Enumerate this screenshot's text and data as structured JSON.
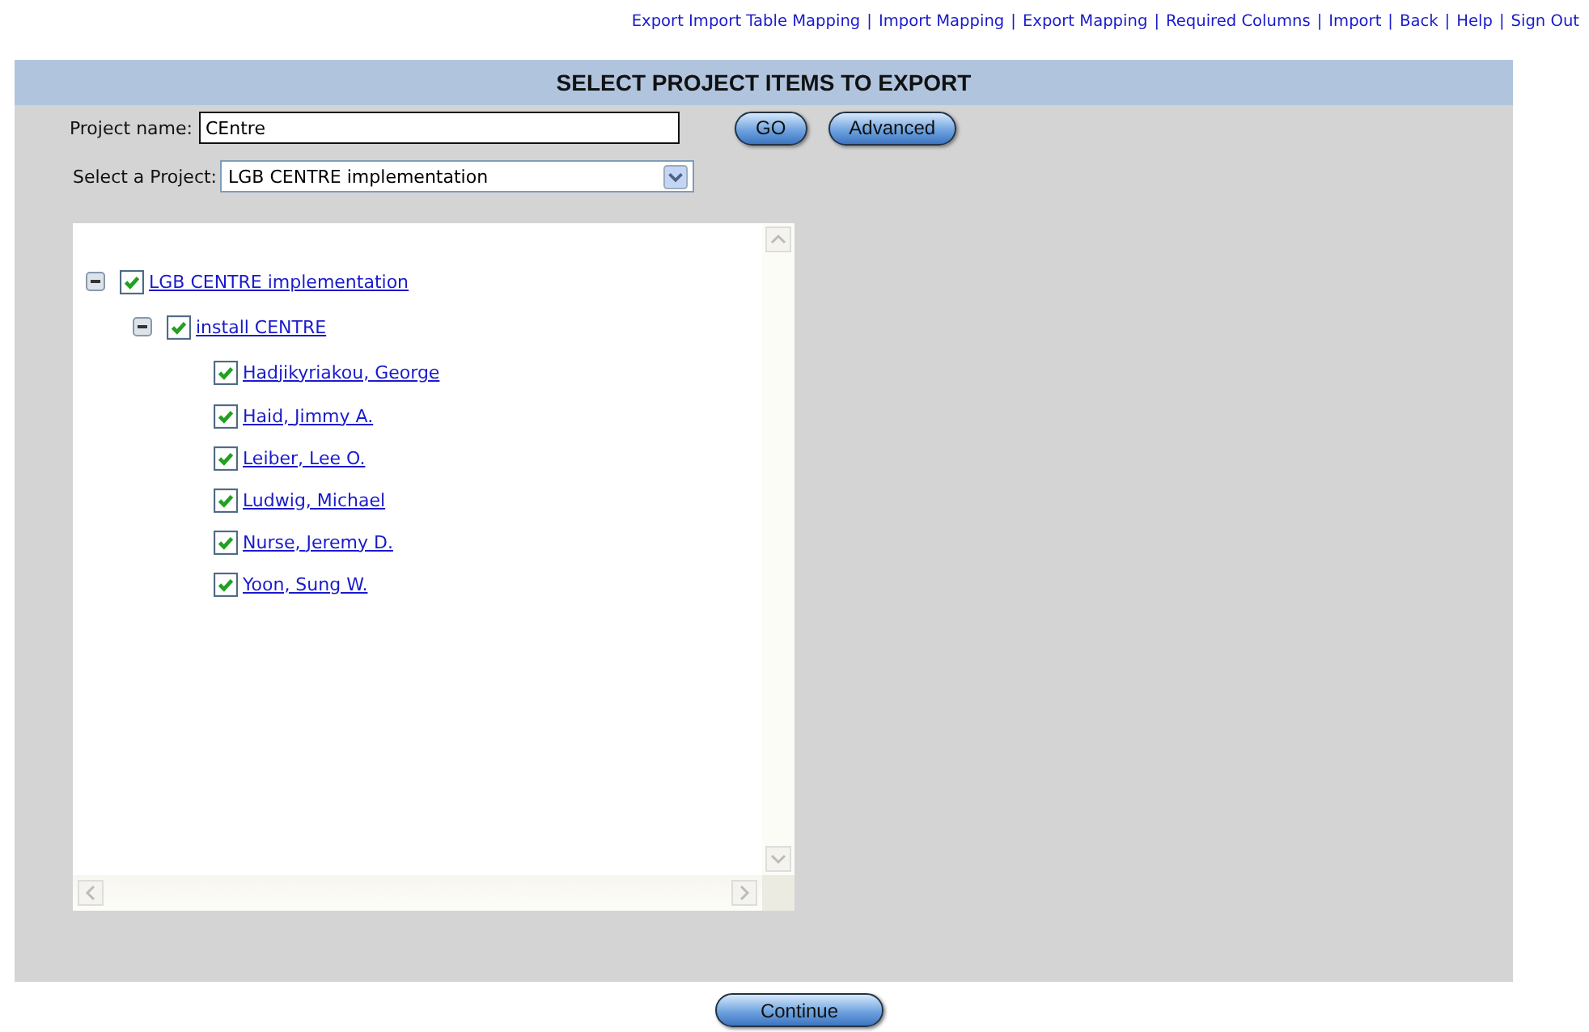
{
  "nav": {
    "separator": "|",
    "links": [
      "Export Import Table Mapping",
      "Import Mapping",
      "Export Mapping",
      "Required Columns",
      "Import",
      "Back",
      "Help",
      "Sign Out"
    ]
  },
  "panel": {
    "title": "SELECT PROJECT ITEMS TO EXPORT",
    "project_name": {
      "label": "Project name:",
      "value": "CEntre"
    },
    "buttons": [
      "GO",
      "Advanced"
    ],
    "project_select": {
      "label": "Select a Project:",
      "value": "LGB CENTRE implementation"
    },
    "tree": [
      {
        "label": "LGB CENTRE implementation",
        "checked": true,
        "expanded": true,
        "children": [
          {
            "label": "install CENTRE",
            "checked": true,
            "expanded": true,
            "children": [
              {
                "label": "Hadjikyriakou, George",
                "checked": true
              },
              {
                "label": "Haid, Jimmy A.",
                "checked": true
              },
              {
                "label": "Leiber, Lee O.",
                "checked": true
              },
              {
                "label": "Ludwig, Michael",
                "checked": true
              },
              {
                "label": "Nurse, Jeremy D.",
                "checked": true
              },
              {
                "label": "Yoon, Sung W.",
                "checked": true
              }
            ]
          }
        ]
      }
    ]
  },
  "continue_button": "Continue"
}
